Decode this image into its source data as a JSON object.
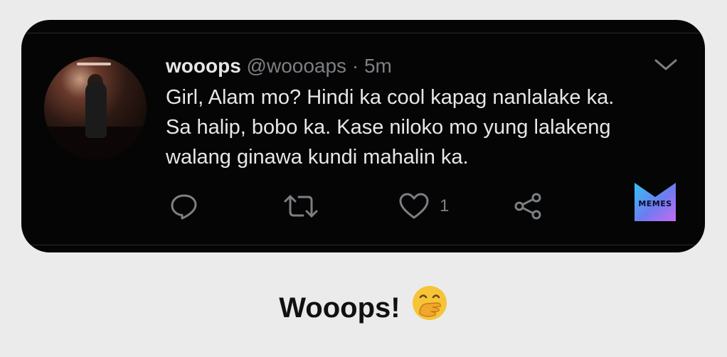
{
  "tweet": {
    "username": "wooops",
    "handle": "@woooaps",
    "separator": "·",
    "time": "5m",
    "text_lines": [
      "Girl, Alam mo? Hindi ka cool kapag nanlalake ka.",
      "Sa halip, bobo ka. Kase niloko mo yung lalakeng",
      "walang ginawa kundi mahalin ka."
    ],
    "actions": {
      "reply_icon": "reply-icon",
      "retweet_icon": "retweet-icon",
      "like_icon": "heart-icon",
      "like_count": "1",
      "share_icon": "share-icon"
    },
    "menu_icon": "chevron-down-icon"
  },
  "watermark": {
    "text": "MEMES"
  },
  "caption": {
    "text": "Wooops!",
    "emoji": "hand-over-mouth-emoji"
  },
  "colors": {
    "page_bg": "#ebebeb",
    "card_bg": "#050505",
    "text_primary": "#e7e7e7",
    "text_secondary": "#7c7f83",
    "icon": "#7c7f83"
  }
}
